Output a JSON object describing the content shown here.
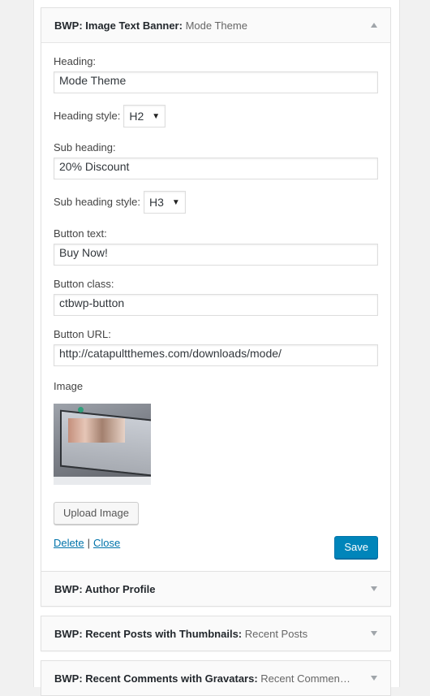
{
  "widgets": {
    "expanded": {
      "title": "BWP: Image Text Banner:",
      "in_title": "Mode Theme",
      "fields": {
        "heading_label": "Heading:",
        "heading_value": "Mode Theme",
        "heading_style_label": "Heading style:",
        "heading_style_value": "H2",
        "sub_heading_label": "Sub heading:",
        "sub_heading_value": "20% Discount",
        "sub_heading_style_label": "Sub heading style:",
        "sub_heading_style_value": "H3",
        "button_text_label": "Button text:",
        "button_text_value": "Buy Now!",
        "button_class_label": "Button class:",
        "button_class_value": "ctbwp-button",
        "button_url_label": "Button URL:",
        "button_url_value": "http://catapultthemes.com/downloads/mode/",
        "image_label": "Image"
      },
      "upload_label": "Upload Image",
      "delete_label": "Delete",
      "separator": "|",
      "close_label": "Close",
      "save_label": "Save"
    },
    "collapsed": [
      {
        "title": "BWP: Author Profile",
        "in_title": ""
      },
      {
        "title": "BWP: Recent Posts with Thumbnails:",
        "in_title": "Recent Posts"
      },
      {
        "title": "BWP: Recent Comments with Gravatars:",
        "in_title": "Recent Commen…"
      }
    ]
  },
  "colors": {
    "primary_button": "#0085ba",
    "link": "#0073aa",
    "background": "#f1f1f1"
  },
  "icons": {
    "expanded_toggle": "caret-up-icon",
    "collapsed_toggle": "caret-down-icon",
    "select_caret": "dropdown-arrow-icon"
  }
}
